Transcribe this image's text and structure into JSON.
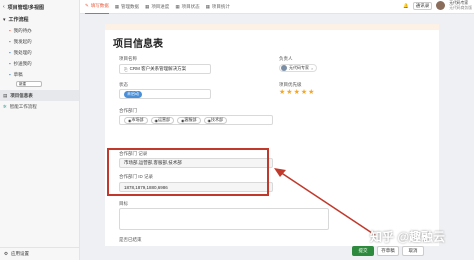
{
  "sidebar": {
    "header": "项目管理/多视图",
    "section_title": "工作流程",
    "items": [
      {
        "label": "我的待办"
      },
      {
        "label": "我发起的"
      },
      {
        "label": "我处理的"
      },
      {
        "label": "抄送我的"
      },
      {
        "label": "草稿"
      }
    ],
    "add_label": "新建",
    "view_item": "项目信息表",
    "smart_item": "智能工作流程",
    "footer": "应用设置"
  },
  "topbar": {
    "tabs": [
      "填写数据",
      "管理数据",
      "项目进度",
      "项目状态",
      "项目统计"
    ],
    "team_label": "通讯录",
    "user_name": "无代码专家",
    "user_sub": "无代码商务版"
  },
  "form": {
    "title": "项目信息表",
    "project_name_label": "项目名称",
    "project_name_value": "CRM 客户关系管理解决方案",
    "owner_label": "负责人",
    "owner_value": "无代码专家",
    "status_label": "状态",
    "status_value": "未启动",
    "progress_label": "项目优先级",
    "stars": 5,
    "dept_label": "合作部门",
    "depts": [
      "市场部",
      "运营部",
      "客服部",
      "技术部"
    ],
    "dept_record_label": "合作部门 记录",
    "dept_record_value": "市场部,运营部,客服部,技术部",
    "dept_id_label": "合作部门 ID 记录",
    "dept_id_value": "1878,1879,1880,6986",
    "goal_label": "目标",
    "ended_label": "是否已结束"
  },
  "actions": {
    "submit": "提交",
    "save_draft": "存草稿",
    "cancel": "取消"
  },
  "watermark": "知乎 @趣融云",
  "colors": {
    "accent": "#e85d3c",
    "highlight": "#c0392b",
    "submit": "#2e8b3d"
  }
}
